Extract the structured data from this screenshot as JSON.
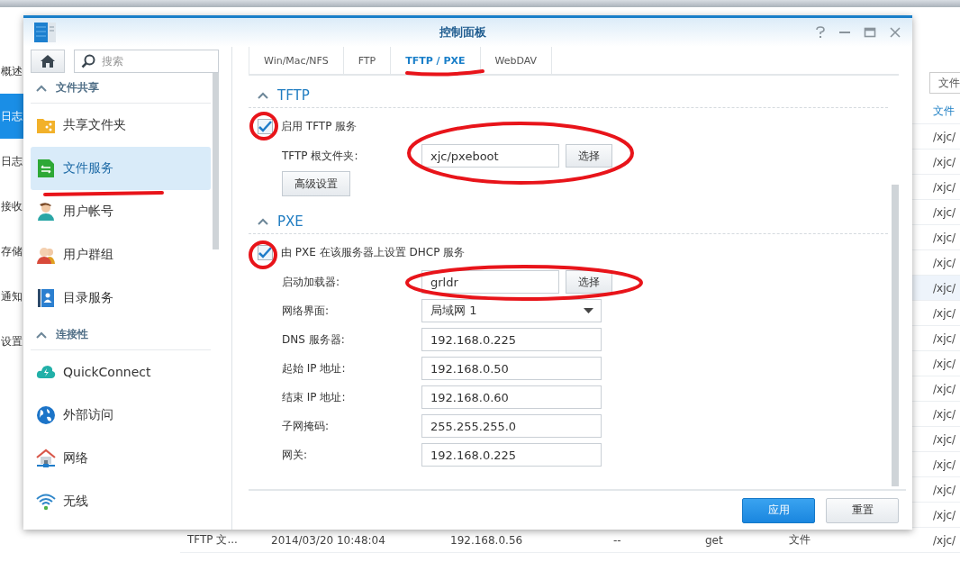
{
  "background_app": {
    "nav_items": [
      {
        "label": "概述",
        "selected": false
      },
      {
        "label": "日志",
        "selected": true
      },
      {
        "label": "日志",
        "selected": false
      },
      {
        "label": "接收",
        "selected": false
      },
      {
        "label": "存储",
        "selected": false
      },
      {
        "label": "通知",
        "selected": false
      },
      {
        "label": "设置",
        "selected": false
      }
    ],
    "filter_field": {
      "value": "文件"
    },
    "table": {
      "column": "文件",
      "rows": [
        {
          "path": "/xjc/"
        },
        {
          "path": "/xjc/"
        },
        {
          "path": "/xjc/"
        },
        {
          "path": "/xjc/"
        },
        {
          "path": "/xjc/"
        },
        {
          "path": "/xjc/"
        },
        {
          "path": "/xjc/",
          "selected": true
        },
        {
          "path": "/xjc/"
        },
        {
          "path": "/xjc/"
        },
        {
          "path": "/xjc/"
        },
        {
          "path": "/xjc/"
        },
        {
          "path": "/xjc/"
        },
        {
          "path": "/xjc/"
        },
        {
          "path": "/xjc/"
        },
        {
          "path": "/xjc/"
        },
        {
          "path": "/xjc/"
        }
      ],
      "bottom_row": {
        "cells": [
          "TFTP 文...",
          "2014/03/20 10:48:04",
          "192.168.0.56",
          "--",
          "get",
          "文件",
          "/xjc/"
        ]
      }
    }
  },
  "dialog": {
    "title": "控制面板",
    "search": {
      "placeholder": "搜索"
    },
    "sidebar": [
      {
        "label": "文件共享",
        "expanded": true,
        "children": [
          {
            "label": "共享文件夹",
            "kind": "folder",
            "selected": false
          },
          {
            "label": "文件服务",
            "kind": "file-service",
            "selected": true
          },
          {
            "label": "用户帐号",
            "kind": "user",
            "selected": false
          },
          {
            "label": "用户群组",
            "kind": "group",
            "selected": false
          },
          {
            "label": "目录服务",
            "kind": "directory",
            "selected": false
          }
        ]
      },
      {
        "label": "连接性",
        "expanded": true,
        "children": [
          {
            "label": "QuickConnect",
            "kind": "cloud",
            "selected": false
          },
          {
            "label": "外部访问",
            "kind": "globe",
            "selected": false
          },
          {
            "label": "网络",
            "kind": "house",
            "selected": false
          },
          {
            "label": "无线",
            "kind": "wifi",
            "selected": false
          }
        ]
      }
    ],
    "tabs": [
      {
        "label": "Win/Mac/NFS",
        "selected": false
      },
      {
        "label": "FTP",
        "selected": false
      },
      {
        "label": "TFTP / PXE",
        "selected": true
      },
      {
        "label": "WebDAV",
        "selected": false
      }
    ],
    "tftp": {
      "title": "TFTP",
      "expanded": true,
      "enable": {
        "label": "启用 TFTP 服务",
        "checked": true
      },
      "root_folder": {
        "label": "TFTP 根文件夹:",
        "value": "xjc/pxeboot",
        "button": "选择"
      },
      "advanced_button": "高级设置"
    },
    "pxe": {
      "title": "PXE",
      "expanded": true,
      "enable": {
        "label": "由 PXE 在该服务器上设置 DHCP 服务",
        "checked": true
      },
      "fields": [
        {
          "kind": "browse",
          "label": "启动加载器:",
          "value": "grldr",
          "button": "选择"
        },
        {
          "kind": "select",
          "label": "网络界面:",
          "value": "局域网 1"
        },
        {
          "kind": "text",
          "label": "DNS 服务器:",
          "value": "192.168.0.225"
        },
        {
          "kind": "text",
          "label": "起始 IP 地址:",
          "value": "192.168.0.50"
        },
        {
          "kind": "text",
          "label": "结束 IP 地址:",
          "value": "192.168.0.60"
        },
        {
          "kind": "text",
          "label": "子网掩码:",
          "value": "255.255.255.0"
        },
        {
          "kind": "text",
          "label": "网关:",
          "value": "192.168.0.225"
        }
      ]
    },
    "footer_buttons": [
      {
        "label": "应用",
        "kind": "primary"
      },
      {
        "label": "重置",
        "kind": "secondary"
      }
    ]
  }
}
